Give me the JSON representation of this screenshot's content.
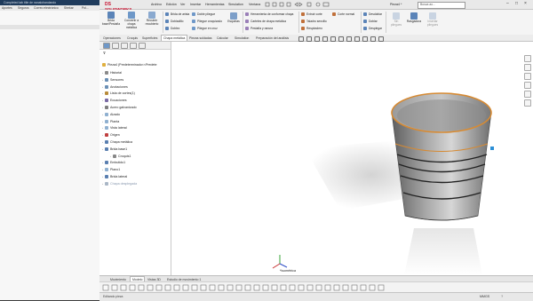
{
  "browser": {
    "tab_title": "Completed tab title de nanalohandando",
    "bookmarks": [
      "Aportes",
      "Seguros",
      "Correo electrónico",
      "Shekar",
      "Pol..."
    ]
  },
  "app": {
    "name_ds": "DS",
    "name": "SOLIDWORKS",
    "menu": [
      "Archivo",
      "Edición",
      "Ver",
      "Insertar",
      "Herramientas",
      "Simulation",
      "Ventana"
    ],
    "doc_name": "Pieza4 *",
    "search_placeholder": "Busca ao..."
  },
  "ribbon": {
    "buttons": [
      {
        "label": "Brida base/Pestaña",
        "icon": "base-flange-icon"
      },
      {
        "label": "Convertir a chapa metálica",
        "icon": "convert-sheetmetal-icon"
      },
      {
        "label": "Recubrir recubierto",
        "icon": "lofted-bend-icon"
      }
    ],
    "small_col1": [
      "Brida de arista",
      "Dobladillo",
      "Doblez"
    ],
    "small_col2": [
      "Doble pliegue",
      "Pliegue croquizado",
      "Pliegue en cruz"
    ],
    "small_col3": [
      "Herramienta de conformar chapa",
      "Carteles de chapa metálica",
      "Pestaña y ranura"
    ],
    "esquinas_label": "Esquinas",
    "small_col4": [
      "Extruir corte",
      "Taladro sencillo",
      "Respiradero"
    ],
    "corte_label": "Corte normal",
    "small_col5": [
      "Desdoblar",
      "Doblar",
      "Desplegar"
    ],
    "right_buttons": [
      "Sin pliegues",
      "Rasgadura",
      "Insertar pliegues"
    ]
  },
  "tabs": [
    "Operaciones",
    "Croquis",
    "Superficies",
    "Chapa metálica",
    "Piezas soldadas",
    "Calcular",
    "Simulation",
    "Preparación del análisis"
  ],
  "active_tab": "Chapa metálica",
  "tree": {
    "part": "Pieza4 (Predeterminado<<Predete",
    "items": [
      {
        "label": "Historial",
        "icon": "history-icon",
        "color": "#8a8a8a"
      },
      {
        "label": "Sensores",
        "icon": "sensor-icon",
        "color": "#6a8fb5"
      },
      {
        "label": "Anotaciones",
        "icon": "annotation-icon",
        "color": "#6a8fb5"
      },
      {
        "label": "Lista de cortes(1)",
        "icon": "cut-list-icon",
        "color": "#b88b3a"
      },
      {
        "label": "Ecuaciones",
        "icon": "equation-icon",
        "color": "#7a6aa5"
      },
      {
        "label": "Acero galvanizado",
        "icon": "material-icon",
        "color": "#7e7e7e"
      },
      {
        "label": "Alzado",
        "icon": "plane-icon",
        "color": "#8fb0d0"
      },
      {
        "label": "Planta",
        "icon": "plane-icon",
        "color": "#8fb0d0"
      },
      {
        "label": "Vista lateral",
        "icon": "plane-icon",
        "color": "#8fb0d0"
      },
      {
        "label": "Origen",
        "icon": "origin-icon",
        "color": "#c04040"
      },
      {
        "label": "Chapa metálica",
        "icon": "sheetmetal-icon",
        "color": "#5a7fb0"
      },
      {
        "label": "Brida base1",
        "icon": "base-flange-icon",
        "color": "#5a7fb0"
      },
      {
        "label": "Croquis1",
        "icon": "sketch-icon",
        "color": "#888888"
      },
      {
        "label": "Embutido1",
        "icon": "feature-icon",
        "color": "#5a7fb0"
      },
      {
        "label": "Plano1",
        "icon": "plane-icon",
        "color": "#8fb0d0"
      },
      {
        "label": "Brida lateral",
        "icon": "edge-flange-icon",
        "color": "#5a7fb0"
      },
      {
        "label": "Chapa desplegada",
        "icon": "flat-pattern-icon",
        "color": "#aab7c6"
      }
    ]
  },
  "viewport": {
    "view_label": "*Isométrica",
    "bucket_color": "#9b9b9b",
    "band_color": "#d68a33"
  },
  "bottom_tabs": [
    "Movimiento",
    "Modelo",
    "Vistas 3D",
    "Estudio de movimiento 1"
  ],
  "active_bottom_tab": "Modelo",
  "status": {
    "units": "MMGS",
    "mode": "Editando pieza"
  }
}
